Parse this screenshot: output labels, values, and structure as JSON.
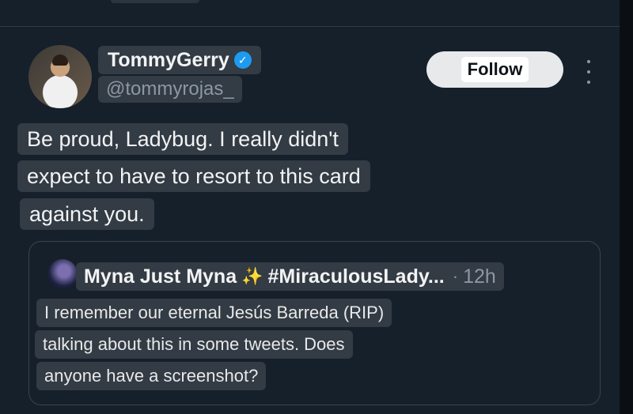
{
  "tweet": {
    "author": {
      "name": "TommyGerry",
      "handle": "@tommyrojas_",
      "verified": true
    },
    "follow_label": "Follow",
    "text_lines": [
      "Be proud, Ladybug. I really didn't",
      "expect to have to resort to this card",
      "against you."
    ]
  },
  "quote": {
    "author": "Myna Just Myna",
    "emoji": "✨",
    "hashtag": "#MiraculousLady...",
    "separator": "·",
    "time": "12h",
    "text_lines": [
      "I remember our eternal Jesús Barreda (RIP)",
      "talking about this in some tweets. Does",
      "anyone have a screenshot?"
    ]
  },
  "colors": {
    "background": "#15202b",
    "verified": "#1d9bf0",
    "muted": "#8b98a5"
  },
  "icons": {
    "verified": "verified-badge-icon",
    "more": "more-options-icon"
  }
}
